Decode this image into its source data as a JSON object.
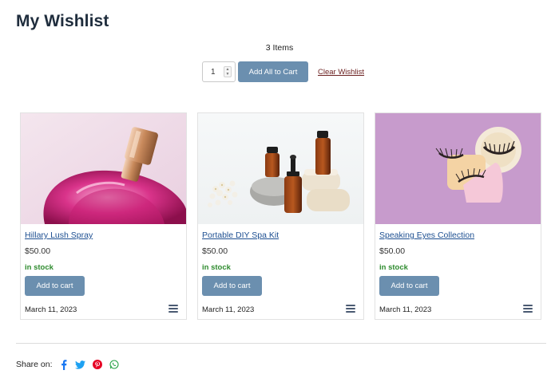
{
  "page": {
    "title": "My Wishlist",
    "item_count": "3 Items"
  },
  "controls": {
    "quantity": "1",
    "add_all_label": "Add All to Cart",
    "clear_label": "Clear Wishlist"
  },
  "products": [
    {
      "name": "Hillary Lush Spray",
      "price": "$50.00",
      "stock": "in stock",
      "button": "Add to cart",
      "date": "March 11, 2023",
      "image": "perfume-bottle-photo"
    },
    {
      "name": "Portable DIY Spa Kit",
      "price": "$50.00",
      "stock": "in stock",
      "button": "Add to cart",
      "date": "March 11, 2023",
      "image": "essential-oil-bottles-photo"
    },
    {
      "name": "Speaking Eyes Collection",
      "price": "$50.00",
      "stock": "in stock",
      "button": "Add to cart",
      "date": "March 11, 2023",
      "image": "false-eyelashes-photo"
    }
  ],
  "share": {
    "label": "Share on:",
    "icons": [
      "facebook-icon",
      "twitter-icon",
      "pinterest-icon",
      "whatsapp-icon"
    ]
  },
  "colors": {
    "title": "#1f2d3d",
    "button": "#6b8faf",
    "link": "#1d4f91",
    "stock": "#2e8b2e",
    "clear_link": "#6b1f1f",
    "facebook": "#1877f2",
    "twitter": "#1da1f2",
    "pinterest": "#e60023",
    "whatsapp": "#25a244"
  }
}
